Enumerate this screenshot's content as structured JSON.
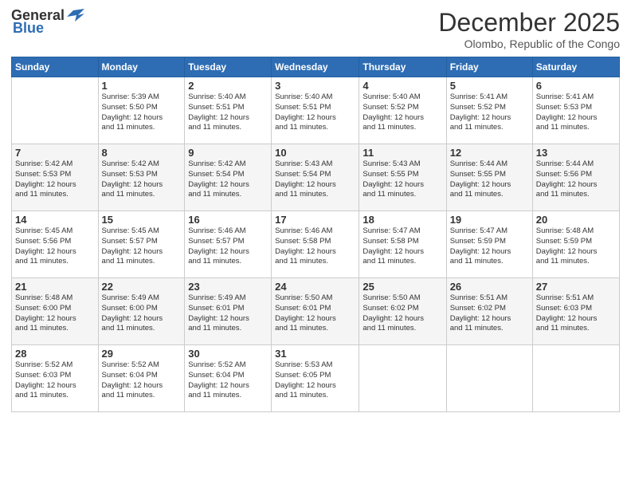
{
  "header": {
    "logo_general": "General",
    "logo_blue": "Blue",
    "main_title": "December 2025",
    "subtitle": "Olombo, Republic of the Congo"
  },
  "columns": [
    "Sunday",
    "Monday",
    "Tuesday",
    "Wednesday",
    "Thursday",
    "Friday",
    "Saturday"
  ],
  "weeks": [
    [
      {
        "day": "",
        "info": ""
      },
      {
        "day": "1",
        "info": "Sunrise: 5:39 AM\nSunset: 5:50 PM\nDaylight: 12 hours\nand 11 minutes."
      },
      {
        "day": "2",
        "info": "Sunrise: 5:40 AM\nSunset: 5:51 PM\nDaylight: 12 hours\nand 11 minutes."
      },
      {
        "day": "3",
        "info": "Sunrise: 5:40 AM\nSunset: 5:51 PM\nDaylight: 12 hours\nand 11 minutes."
      },
      {
        "day": "4",
        "info": "Sunrise: 5:40 AM\nSunset: 5:52 PM\nDaylight: 12 hours\nand 11 minutes."
      },
      {
        "day": "5",
        "info": "Sunrise: 5:41 AM\nSunset: 5:52 PM\nDaylight: 12 hours\nand 11 minutes."
      },
      {
        "day": "6",
        "info": "Sunrise: 5:41 AM\nSunset: 5:53 PM\nDaylight: 12 hours\nand 11 minutes."
      }
    ],
    [
      {
        "day": "7",
        "info": "Sunrise: 5:42 AM\nSunset: 5:53 PM\nDaylight: 12 hours\nand 11 minutes."
      },
      {
        "day": "8",
        "info": "Sunrise: 5:42 AM\nSunset: 5:53 PM\nDaylight: 12 hours\nand 11 minutes."
      },
      {
        "day": "9",
        "info": "Sunrise: 5:42 AM\nSunset: 5:54 PM\nDaylight: 12 hours\nand 11 minutes."
      },
      {
        "day": "10",
        "info": "Sunrise: 5:43 AM\nSunset: 5:54 PM\nDaylight: 12 hours\nand 11 minutes."
      },
      {
        "day": "11",
        "info": "Sunrise: 5:43 AM\nSunset: 5:55 PM\nDaylight: 12 hours\nand 11 minutes."
      },
      {
        "day": "12",
        "info": "Sunrise: 5:44 AM\nSunset: 5:55 PM\nDaylight: 12 hours\nand 11 minutes."
      },
      {
        "day": "13",
        "info": "Sunrise: 5:44 AM\nSunset: 5:56 PM\nDaylight: 12 hours\nand 11 minutes."
      }
    ],
    [
      {
        "day": "14",
        "info": "Sunrise: 5:45 AM\nSunset: 5:56 PM\nDaylight: 12 hours\nand 11 minutes."
      },
      {
        "day": "15",
        "info": "Sunrise: 5:45 AM\nSunset: 5:57 PM\nDaylight: 12 hours\nand 11 minutes."
      },
      {
        "day": "16",
        "info": "Sunrise: 5:46 AM\nSunset: 5:57 PM\nDaylight: 12 hours\nand 11 minutes."
      },
      {
        "day": "17",
        "info": "Sunrise: 5:46 AM\nSunset: 5:58 PM\nDaylight: 12 hours\nand 11 minutes."
      },
      {
        "day": "18",
        "info": "Sunrise: 5:47 AM\nSunset: 5:58 PM\nDaylight: 12 hours\nand 11 minutes."
      },
      {
        "day": "19",
        "info": "Sunrise: 5:47 AM\nSunset: 5:59 PM\nDaylight: 12 hours\nand 11 minutes."
      },
      {
        "day": "20",
        "info": "Sunrise: 5:48 AM\nSunset: 5:59 PM\nDaylight: 12 hours\nand 11 minutes."
      }
    ],
    [
      {
        "day": "21",
        "info": "Sunrise: 5:48 AM\nSunset: 6:00 PM\nDaylight: 12 hours\nand 11 minutes."
      },
      {
        "day": "22",
        "info": "Sunrise: 5:49 AM\nSunset: 6:00 PM\nDaylight: 12 hours\nand 11 minutes."
      },
      {
        "day": "23",
        "info": "Sunrise: 5:49 AM\nSunset: 6:01 PM\nDaylight: 12 hours\nand 11 minutes."
      },
      {
        "day": "24",
        "info": "Sunrise: 5:50 AM\nSunset: 6:01 PM\nDaylight: 12 hours\nand 11 minutes."
      },
      {
        "day": "25",
        "info": "Sunrise: 5:50 AM\nSunset: 6:02 PM\nDaylight: 12 hours\nand 11 minutes."
      },
      {
        "day": "26",
        "info": "Sunrise: 5:51 AM\nSunset: 6:02 PM\nDaylight: 12 hours\nand 11 minutes."
      },
      {
        "day": "27",
        "info": "Sunrise: 5:51 AM\nSunset: 6:03 PM\nDaylight: 12 hours\nand 11 minutes."
      }
    ],
    [
      {
        "day": "28",
        "info": "Sunrise: 5:52 AM\nSunset: 6:03 PM\nDaylight: 12 hours\nand 11 minutes."
      },
      {
        "day": "29",
        "info": "Sunrise: 5:52 AM\nSunset: 6:04 PM\nDaylight: 12 hours\nand 11 minutes."
      },
      {
        "day": "30",
        "info": "Sunrise: 5:52 AM\nSunset: 6:04 PM\nDaylight: 12 hours\nand 11 minutes."
      },
      {
        "day": "31",
        "info": "Sunrise: 5:53 AM\nSunset: 6:05 PM\nDaylight: 12 hours\nand 11 minutes."
      },
      {
        "day": "",
        "info": ""
      },
      {
        "day": "",
        "info": ""
      },
      {
        "day": "",
        "info": ""
      }
    ]
  ]
}
